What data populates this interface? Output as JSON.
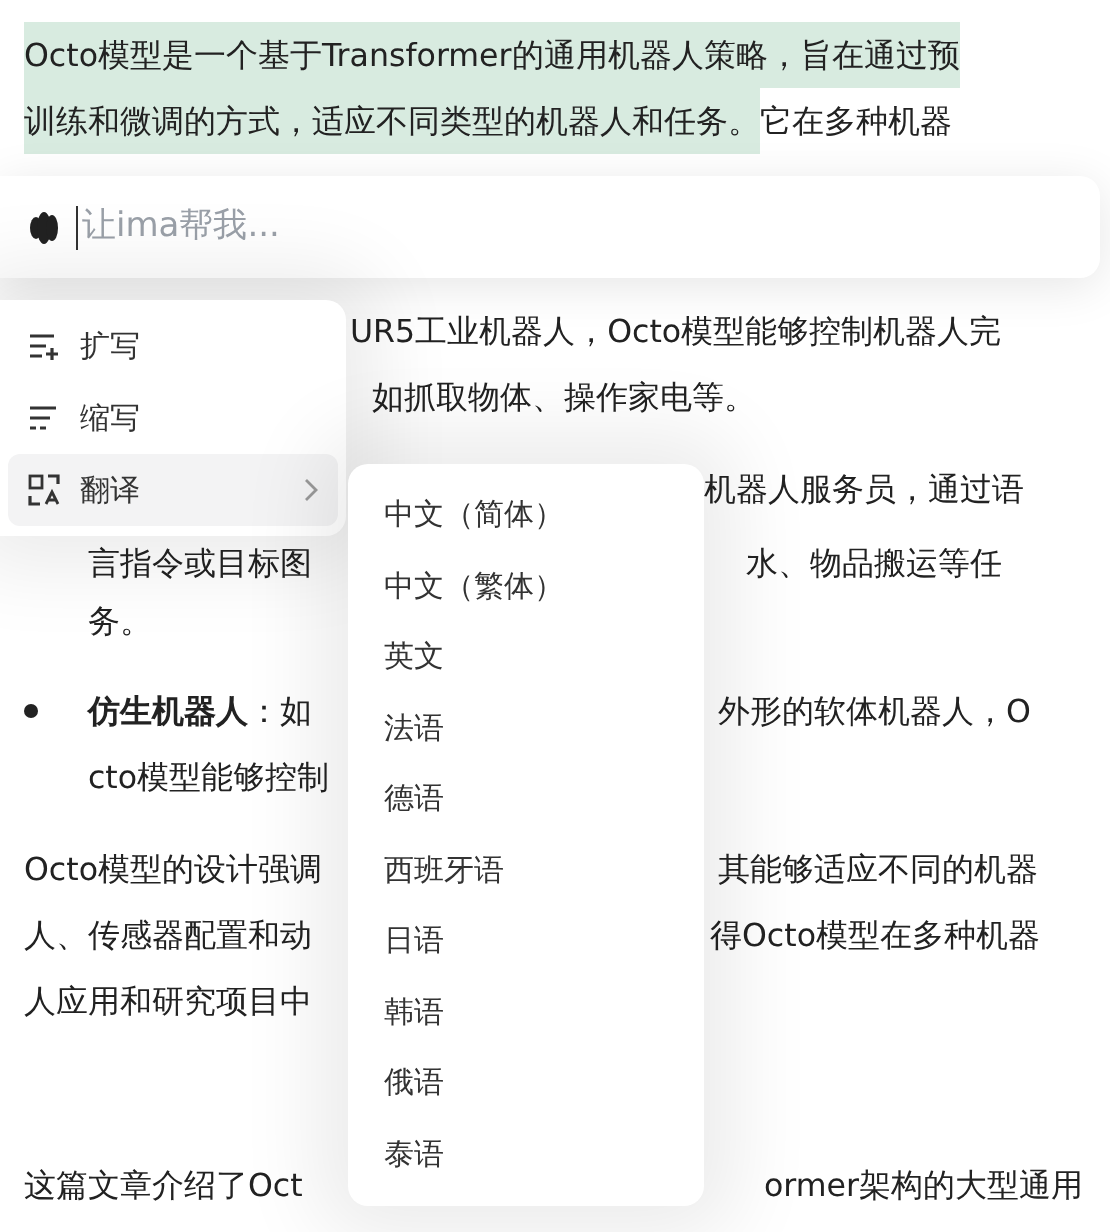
{
  "document": {
    "lines": [
      {
        "segments": [
          {
            "text": "Octo模型是一个基于Transformer的通用机器人策略，旨在通过预",
            "highlighted": true
          }
        ]
      },
      {
        "segments": [
          {
            "text": "训练和微调的方式，适应不同类型的机器人和任务。",
            "highlighted": true
          },
          {
            "text": "它在多种机器",
            "highlighted": false
          }
        ]
      },
      {
        "segments": [
          {
            "text": "UR5工业机器人，Octo模型能够控制机器人完"
          }
        ]
      },
      {
        "segments": [
          {
            "text": "如抓取物体、操作家电等。"
          }
        ]
      },
      {
        "segments": [
          {
            "text": "机器人服务员，通过语"
          }
        ]
      },
      {
        "segments": [
          {
            "text": "言指令或目标图"
          },
          {
            "text": "水、物品搬运等任"
          }
        ]
      },
      {
        "segments": [
          {
            "text": "务。"
          }
        ]
      },
      {
        "bullet": true,
        "segments": [
          {
            "text": "**仿生机器人**：如"
          },
          {
            "text": "外形的软体机器人，O"
          }
        ]
      },
      {
        "segments": [
          {
            "text": "cto模型能够控制"
          }
        ]
      },
      {
        "segments": [
          {
            "text": "Octo模型的设计强调"
          },
          {
            "text": "其能够适应不同的机器"
          }
        ]
      },
      {
        "segments": [
          {
            "text": "人、传感器配置和动"
          },
          {
            "text": "得Octo模型在多种机器"
          }
        ]
      },
      {
        "segments": [
          {
            "text": "人应用和研究项目中"
          }
        ]
      },
      {
        "segments": [
          {
            "text": "这篇文章介绍了Oct"
          },
          {
            "text": "ormer架构的大型通用"
          }
        ]
      }
    ]
  },
  "prompt_bar": {
    "placeholder": "让ima帮我..."
  },
  "action_menu": {
    "items": [
      {
        "kind": "expand",
        "label": "扩写",
        "selected": false,
        "submenu": false
      },
      {
        "kind": "shorten",
        "label": "缩写",
        "selected": false,
        "submenu": false
      },
      {
        "kind": "translate",
        "label": "翻译",
        "selected": true,
        "submenu": true
      }
    ]
  },
  "language_menu": {
    "items": [
      {
        "label": "中文（简体）"
      },
      {
        "label": "中文（繁体）"
      },
      {
        "label": "英文"
      },
      {
        "label": "法语"
      },
      {
        "label": "德语"
      },
      {
        "label": "西班牙语"
      },
      {
        "label": "日语"
      },
      {
        "label": "韩语"
      },
      {
        "label": "俄语"
      },
      {
        "label": "泰语"
      }
    ]
  }
}
